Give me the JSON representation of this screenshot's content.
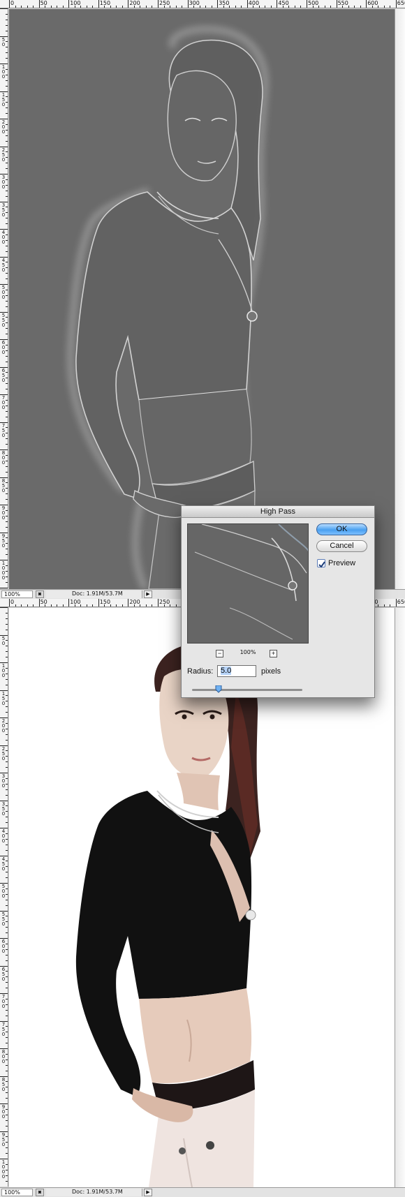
{
  "top_window": {
    "status": {
      "zoom": "100%",
      "doc_info": "Doc: 1.91M/53.7M",
      "camera_icon": "camera-icon",
      "menu_arrow_icon": "triangle-right-icon"
    }
  },
  "bottom_window": {
    "status": {
      "zoom": "100%",
      "doc_info": "Doc: 1.91M/53.7M",
      "camera_icon": "camera-icon",
      "menu_arrow_icon": "triangle-right-icon"
    }
  },
  "ruler": {
    "horizontal_labels": [
      "0",
      "50",
      "100",
      "150",
      "200",
      "250",
      "300",
      "350",
      "400",
      "450",
      "500",
      "550",
      "600",
      "650"
    ],
    "vertical_labels_top": [
      "50",
      "100",
      "150",
      "200",
      "250",
      "300",
      "350",
      "400",
      "450",
      "500",
      "550",
      "600",
      "650",
      "700",
      "750",
      "800",
      "850",
      "900",
      "950",
      "1000",
      "1050"
    ],
    "vertical_labels_bottom": [
      "50",
      "100",
      "150",
      "200",
      "250",
      "300",
      "350",
      "400",
      "450",
      "500",
      "550",
      "600",
      "650",
      "700",
      "750",
      "800",
      "850",
      "900",
      "950",
      "1000",
      "1050"
    ]
  },
  "dialog": {
    "title": "High Pass",
    "ok_label": "OK",
    "cancel_label": "Cancel",
    "preview_label": "Preview",
    "preview_checked": true,
    "preview_zoom": "100%",
    "zoom_out_label": "−",
    "zoom_in_label": "+",
    "radius_label": "Radius:",
    "radius_value": "5.0",
    "units_label": "pixels",
    "slider_value_fraction": 0.24
  },
  "colors": {
    "accent_button": "#4aa0f0",
    "highpass_gray": "#6a6a6a",
    "photo_background": "#ffffff"
  }
}
